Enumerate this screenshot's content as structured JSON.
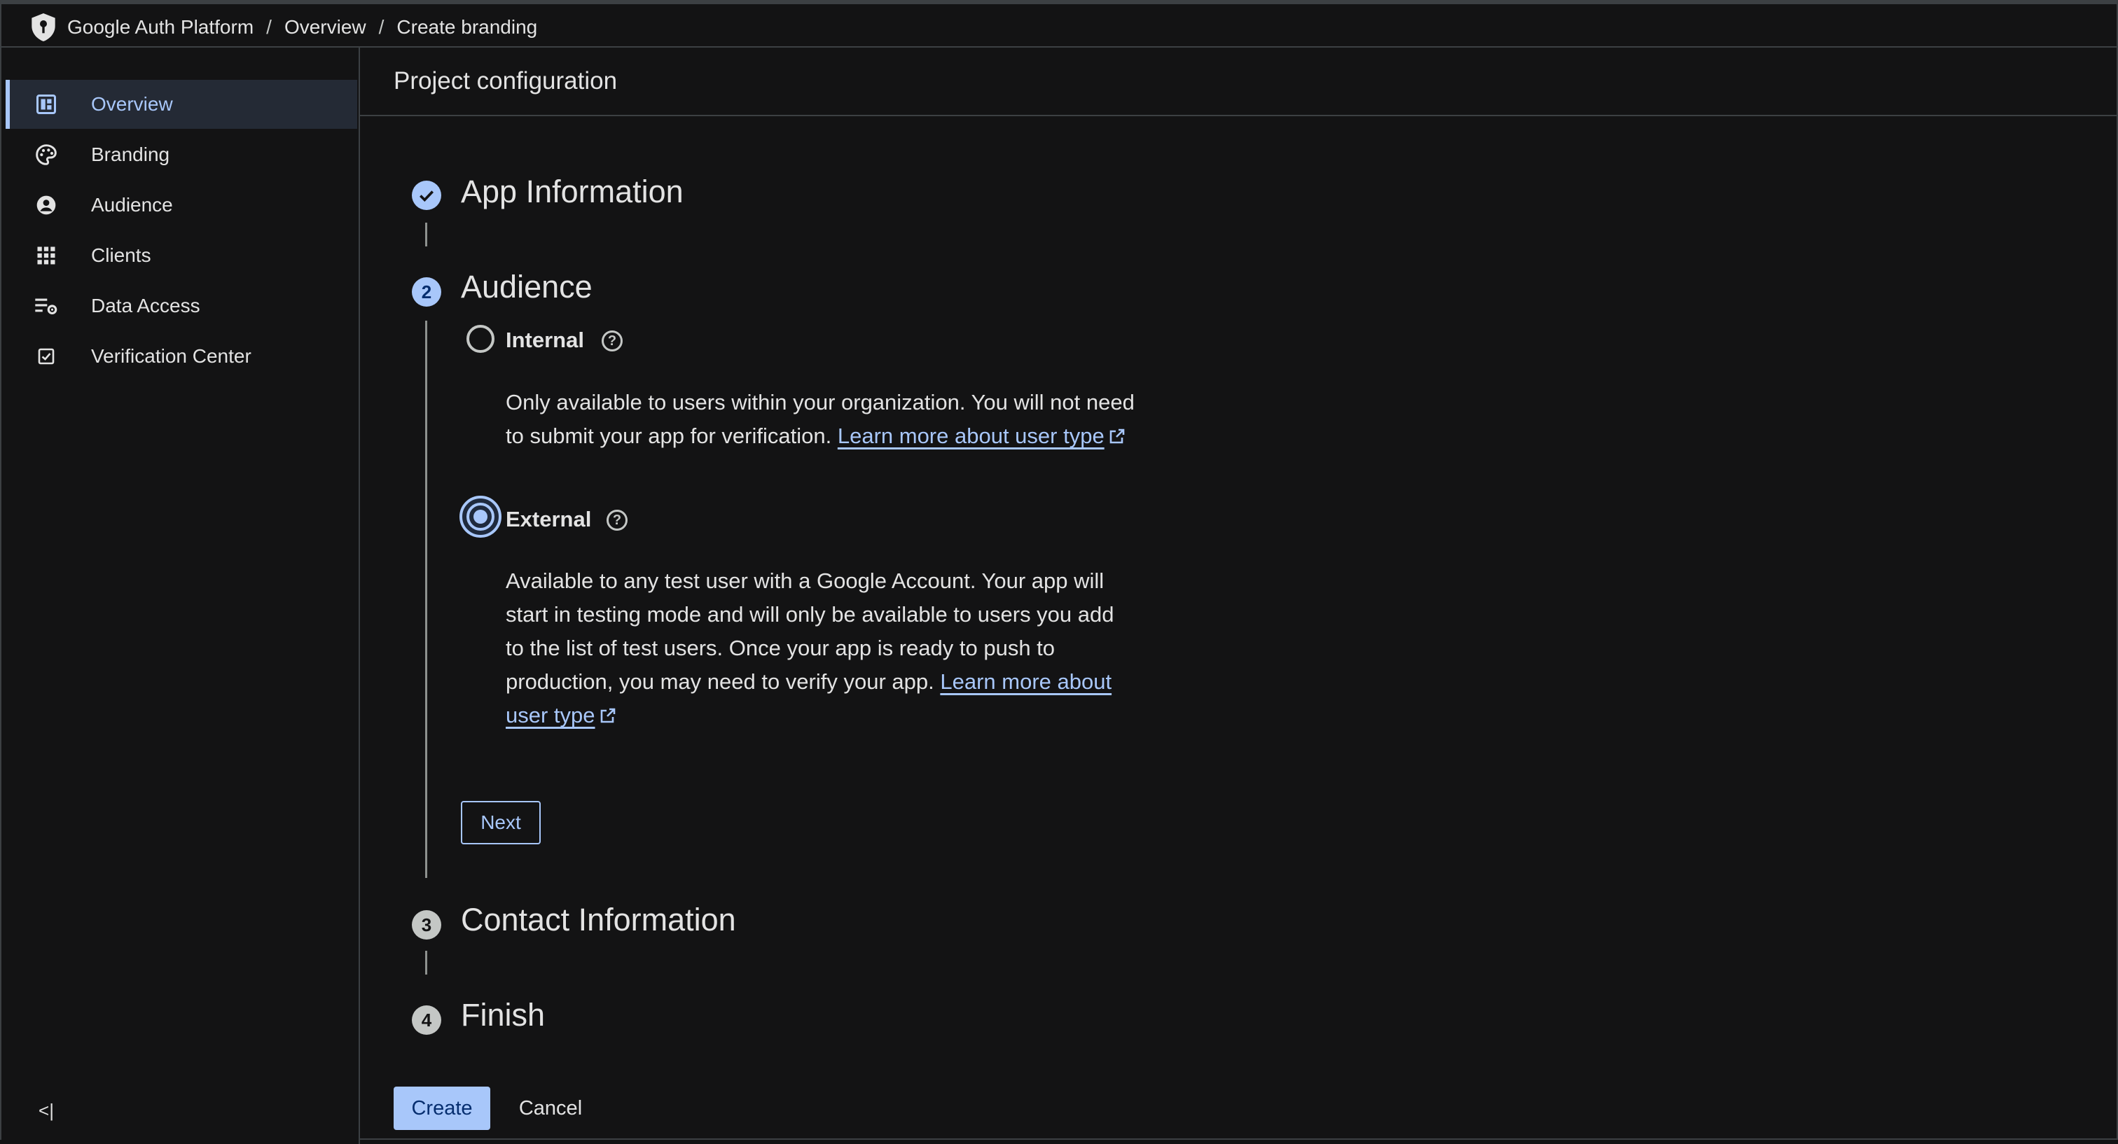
{
  "breadcrumb": {
    "items": [
      "Google Auth Platform",
      "Overview",
      "Create branding"
    ]
  },
  "sidebar": {
    "items": [
      {
        "label": "Overview",
        "icon": "dashboard-icon",
        "active": true
      },
      {
        "label": "Branding",
        "icon": "palette-icon"
      },
      {
        "label": "Audience",
        "icon": "account-circle-icon"
      },
      {
        "label": "Clients",
        "icon": "apps-grid-icon"
      },
      {
        "label": "Data Access",
        "icon": "list-settings-icon"
      },
      {
        "label": "Verification Center",
        "icon": "checkbox-icon"
      }
    ],
    "collapse_label": "<|"
  },
  "main": {
    "title": "Project configuration",
    "steps": [
      {
        "number": "1",
        "title": "App Information",
        "state": "done"
      },
      {
        "number": "2",
        "title": "Audience",
        "state": "current"
      },
      {
        "number": "3",
        "title": "Contact Information",
        "state": "pending"
      },
      {
        "number": "4",
        "title": "Finish",
        "state": "pending"
      }
    ],
    "audience": {
      "internal": {
        "label": "Internal",
        "checked": false,
        "description": "Only available to users within your organization. You will not need to submit your app for verification.",
        "link": "Learn more about user type"
      },
      "external": {
        "label": "External",
        "checked": true,
        "description": "Available to any test user with a Google Account. Your app will start in testing mode and will only be available to users you add to the list of test users. Once your app is ready to push to production, you may need to verify your app.",
        "link": "Learn more about user type"
      },
      "next_label": "Next"
    },
    "create_label": "Create",
    "cancel_label": "Cancel"
  },
  "colors": {
    "accent": "#a8c7fa",
    "background": "#131314",
    "border": "#3c4043"
  }
}
